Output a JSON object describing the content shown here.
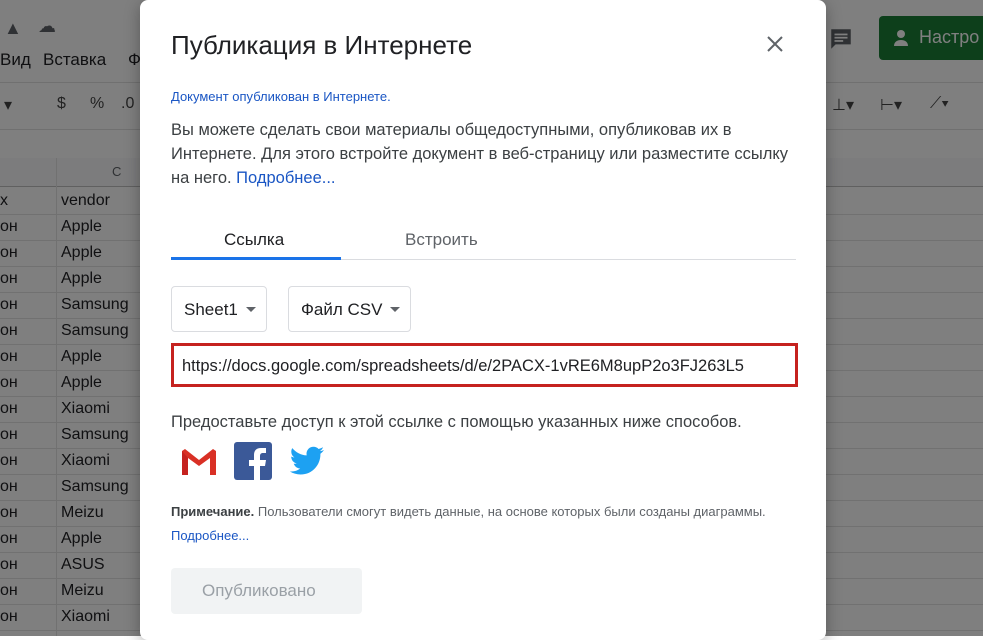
{
  "background": {
    "menu": [
      "Вид",
      "Вставка",
      "Ф"
    ],
    "toolbar": [
      "$",
      "%",
      ".0"
    ],
    "column_header": "C",
    "share_button": "Настро",
    "rows": [
      {
        "a": "x",
        "c": "vendor"
      },
      {
        "a": "он",
        "c": "Apple"
      },
      {
        "a": "он",
        "c": "Apple"
      },
      {
        "a": "он",
        "c": "Apple"
      },
      {
        "a": "он",
        "c": "Samsung"
      },
      {
        "a": "он",
        "c": "Samsung"
      },
      {
        "a": "он",
        "c": "Apple"
      },
      {
        "a": "он",
        "c": "Apple"
      },
      {
        "a": "он",
        "c": "Xiaomi"
      },
      {
        "a": "он",
        "c": "Samsung"
      },
      {
        "a": "он",
        "c": "Xiaomi"
      },
      {
        "a": "он",
        "c": "Samsung"
      },
      {
        "a": "он",
        "c": "Meizu"
      },
      {
        "a": "он",
        "c": "Apple"
      },
      {
        "a": "он",
        "c": "ASUS"
      },
      {
        "a": "он",
        "c": "Meizu"
      },
      {
        "a": "он",
        "c": "Xiaomi"
      }
    ]
  },
  "dialog": {
    "title": "Публикация в Интернете",
    "status": "Документ опубликован в Интернете.",
    "description": "Вы можете сделать свои материалы общедоступными, опубликовав их в Интернете. Для этого встройте документ в веб-страницу или разместите ссылку на него.",
    "learn_more": "Подробнее...",
    "tabs": {
      "link": "Ссылка",
      "embed": "Встроить"
    },
    "sheet_select": "Sheet1",
    "format_select": "Файл CSV",
    "url": "https://docs.google.com/spreadsheets/d/e/2PACX-1vRE6M8upP2o3FJ263L5",
    "share_prompt": "Предоставьте доступ к этой ссылке с помощью указанных ниже способов.",
    "note_label": "Примечание.",
    "note_text": "Пользователи смогут видеть данные, на основе которых были созданы диаграммы.",
    "note_link": "Подробнее...",
    "publish_button": "Опубликовано",
    "social": [
      "gmail-icon",
      "facebook-icon",
      "twitter-icon"
    ]
  },
  "colors": {
    "accent": "#1a73e8",
    "highlight_border": "#c5221f",
    "share_green": "#1a7f37",
    "link": "#1a56c4"
  }
}
